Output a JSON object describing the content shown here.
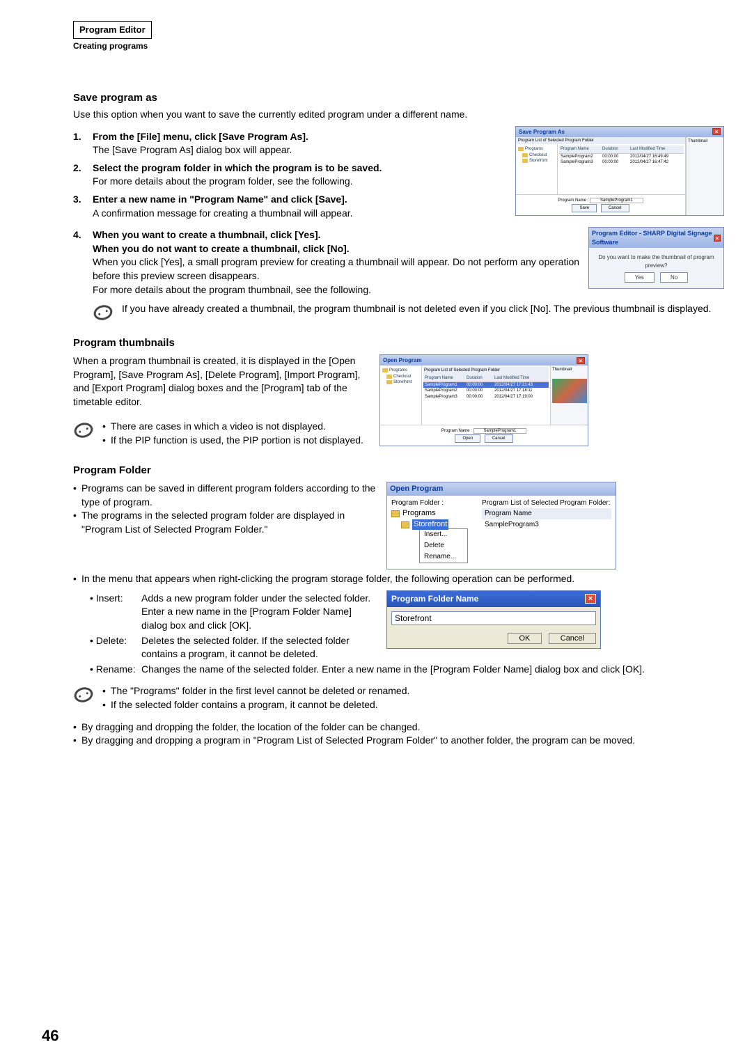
{
  "header": {
    "box": "Program Editor",
    "sub": "Creating programs"
  },
  "saveAs": {
    "title": "Save program as",
    "intro": "Use this option when you want to save the currently edited program under a different name.",
    "s1b": "From the [File] menu, click [Save Program As].",
    "s1t": "The [Save Program As] dialog box will appear.",
    "s2b": "Select the program folder in which the program is to be saved.",
    "s2t": "For more details about the program folder, see the following.",
    "s3b": "Enter a new name in \"Program Name\" and click [Save].",
    "s3t": "A confirmation message for creating a thumbnail will appear.",
    "s4b1": "When you want to create a thumbnail, click [Yes].",
    "s4b2": "When you do not want to create a thumbnail, click [No].",
    "s4t1": "When you click [Yes], a small program preview for creating a thumbnail will appear. Do not perform any operation before this preview screen disappears.",
    "s4t2": "For more details about the program thumbnail, see the following.",
    "note": "If you have already created a thumbnail, the program thumbnail is not deleted even if you click [No]. The previous thumbnail is displayed."
  },
  "dlgSave": {
    "title": "Save Program As",
    "listTitle": "Program List of Selected Program Folder",
    "thumbLabel": "Thumbnail",
    "tree": [
      "Programs",
      "Checkout",
      "Storefront"
    ],
    "cols": [
      "Program Name",
      "Duration",
      "Last Modified Time"
    ],
    "rows": [
      [
        "SampleProgram2",
        "00:00:00",
        "2012/04/27 16:49:49"
      ],
      [
        "SampleProgram3",
        "00:00:00",
        "2012/04/27 16:47:42"
      ]
    ],
    "nameLabel": "Program Name :",
    "nameVal": "SampleProgram1",
    "save": "Save",
    "cancel": "Cancel"
  },
  "dlgConfirm": {
    "title": "Program Editor - SHARP Digital Signage Software",
    "msg": "Do you want to make the thumbnail of program preview?",
    "yes": "Yes",
    "no": "No"
  },
  "thumbs": {
    "title": "Program thumbnails",
    "p": "When a program thumbnail is created, it is displayed in the [Open Program], [Save Program As], [Delete Program], [Import Program], and [Export Program] dialog boxes and the [Program] tab of the timetable editor.",
    "n1": "There are cases in which a video is not displayed.",
    "n2": "If the PIP function is used, the PIP portion is not displayed."
  },
  "dlgOpen": {
    "title": "Open Program",
    "rows": [
      [
        "SampleProgram1",
        "00:00:00",
        "2012/04/27 17:21:43"
      ],
      [
        "SampleProgram2",
        "00:00:00",
        "2012/04/27 17:18:11"
      ],
      [
        "SampleProgram3",
        "00:00:00",
        "2012/04/27 17:19:00"
      ]
    ],
    "nameVal": "SampleProgram1",
    "open": "Open",
    "cancel": "Cancel"
  },
  "folder": {
    "title": "Program Folder",
    "b1": "Programs can be saved in different program folders according to the type of program.",
    "b2": "The programs in the selected program folder are displayed in \"Program List of Selected Program Folder.\"",
    "b3": "In the menu that appears when right-clicking the program storage folder, the following operation can be performed.",
    "insertT": "• Insert:",
    "insertD": "Adds a new program folder under the selected folder. Enter a new name in the [Program Folder Name] dialog box and click [OK].",
    "deleteT": "• Delete:",
    "deleteD": "Deletes the selected folder. If the selected folder contains a program, it cannot be deleted.",
    "renameT": "• Rename:",
    "renameD": "Changes the name of the selected folder. Enter a new name in the [Program Folder Name] dialog box and click [OK].",
    "n1": "The \"Programs\" folder in the first level cannot be deleted or renamed.",
    "n2": "If the selected folder contains a program, it cannot be deleted.",
    "b4": "By dragging and dropping the folder, the location of the folder can be changed.",
    "b5": "By dragging and dropping a program in \"Program List of Selected Program Folder\" to another folder, the program can be moved."
  },
  "dlgOpenProg": {
    "title": "Open Program",
    "folderLabel": "Program Folder :",
    "listLabel": "Program List of Selected Program Folder:",
    "treeRoot": "Programs",
    "treeSel": "Storefront",
    "menu": [
      "Insert...",
      "Delete",
      "Rename..."
    ],
    "colHead": "Program Name",
    "row": "SampleProgram3"
  },
  "dlgPfName": {
    "title": "Program Folder Name",
    "value": "Storefront",
    "ok": "OK",
    "cancel": "Cancel"
  },
  "pageNum": "46"
}
